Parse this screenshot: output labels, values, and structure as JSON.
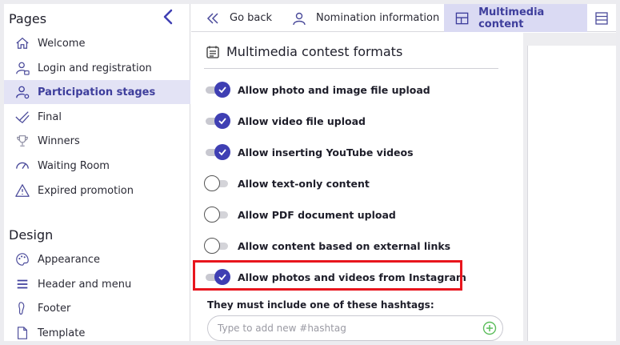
{
  "sidebar": {
    "sections": {
      "pages": "Pages",
      "design": "Design"
    },
    "pages_items": [
      {
        "label": "Welcome",
        "icon": "home-icon"
      },
      {
        "label": "Login and registration",
        "icon": "user-lock-icon"
      },
      {
        "label": "Participation stages",
        "icon": "user-settings-icon",
        "active": true
      },
      {
        "label": "Final",
        "icon": "double-check-icon"
      },
      {
        "label": "Winners",
        "icon": "trophy-icon"
      },
      {
        "label": "Waiting Room",
        "icon": "gauge-icon"
      },
      {
        "label": "Expired promotion",
        "icon": "warning-icon"
      }
    ],
    "design_items": [
      {
        "label": "Appearance",
        "icon": "palette-icon"
      },
      {
        "label": "Header and menu",
        "icon": "menu-icon"
      },
      {
        "label": "Footer",
        "icon": "footer-icon"
      },
      {
        "label": "Template",
        "icon": "template-icon"
      }
    ]
  },
  "tabs": [
    {
      "label": "Go back",
      "icon": "double-chevron-left-icon"
    },
    {
      "label": "Nomination information",
      "icon": "user-icon"
    },
    {
      "label": "Multimedia content",
      "icon": "layout-icon",
      "active": true
    }
  ],
  "panel": {
    "title": "Multimedia contest formats",
    "options": [
      {
        "label": "Allow photo and image file upload",
        "on": true
      },
      {
        "label": "Allow video file upload",
        "on": true
      },
      {
        "label": "Allow inserting YouTube videos",
        "on": true
      },
      {
        "label": "Allow text-only content",
        "on": false
      },
      {
        "label": "Allow PDF document upload",
        "on": false
      },
      {
        "label": "Allow content based on external links",
        "on": false
      },
      {
        "label": "Allow photos and videos from Instagram",
        "on": true
      }
    ],
    "hashtag_label": "They must include one of these hashtags:",
    "hashtag_placeholder": "Type to add new #hashtag"
  },
  "colors": {
    "accent": "#3f3fb3",
    "active_bg": "#e3e3f5",
    "highlight": "#e8151d",
    "plus_green": "#5bbd5b"
  }
}
